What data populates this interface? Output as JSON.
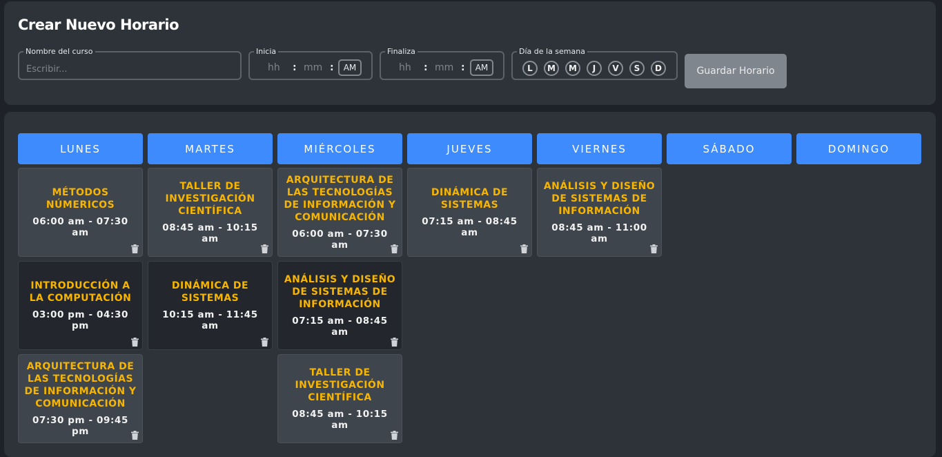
{
  "form": {
    "title": "Crear Nuevo Horario",
    "course_label": "Nombre del curso",
    "course_placeholder": "Escribir...",
    "start_label": "Inicia",
    "end_label": "Finaliza",
    "hour_placeholder": "hh",
    "minute_placeholder": "mm",
    "separator": ":",
    "start_ampm": "AM",
    "end_ampm": "AM",
    "weekday_label": "Día de la semana",
    "weekday_options": [
      "L",
      "M",
      "M",
      "J",
      "V",
      "S",
      "D"
    ],
    "save_label": "Guardar Horario"
  },
  "colors": {
    "accent": "#3d8bfd",
    "course_name": "#f7b500",
    "panel": "#2e3339",
    "background": "#1e2228"
  },
  "schedule": {
    "days": [
      "LUNES",
      "MARTES",
      "MIÉRCOLES",
      "JUEVES",
      "VIERNES",
      "SÁBADO",
      "DOMINGO"
    ],
    "columns": [
      [
        {
          "name": "MÉTODOS NÚMERICOS",
          "time": "06:00 am - 07:30 am"
        },
        {
          "name": "INTRODUCCIÓN A LA COMPUTACIÓN",
          "time": "03:00 pm - 04:30 pm"
        },
        {
          "name": "ARQUITECTURA DE LAS TECNOLOGÍAS DE INFORMACIÓN Y COMUNICACIÓN",
          "time": "07:30 pm - 09:45 pm"
        }
      ],
      [
        {
          "name": "TALLER DE INVESTIGACIÓN CIENTÍFICA",
          "time": "08:45 am - 10:15 am"
        },
        {
          "name": "DINÁMICA DE SISTEMAS",
          "time": "10:15 am - 11:45 am"
        }
      ],
      [
        {
          "name": "ARQUITECTURA DE LAS TECNOLOGÍAS DE INFORMACIÓN Y COMUNICACIÓN",
          "time": "06:00 am - 07:30 am"
        },
        {
          "name": "ANÁLISIS Y DISEÑO DE SISTEMAS DE INFORMACIÓN",
          "time": "07:15 am - 08:45 am"
        },
        {
          "name": "TALLER DE INVESTIGACIÓN CIENTÍFICA",
          "time": "08:45 am - 10:15 am"
        }
      ],
      [
        {
          "name": "DINÁMICA DE SISTEMAS",
          "time": "07:15 am - 08:45 am"
        }
      ],
      [
        {
          "name": "ANÁLISIS Y DISEÑO DE SISTEMAS DE INFORMACIÓN",
          "time": "08:45 am - 11:00 am"
        }
      ],
      [],
      []
    ],
    "delete_icon": "trash-icon"
  }
}
